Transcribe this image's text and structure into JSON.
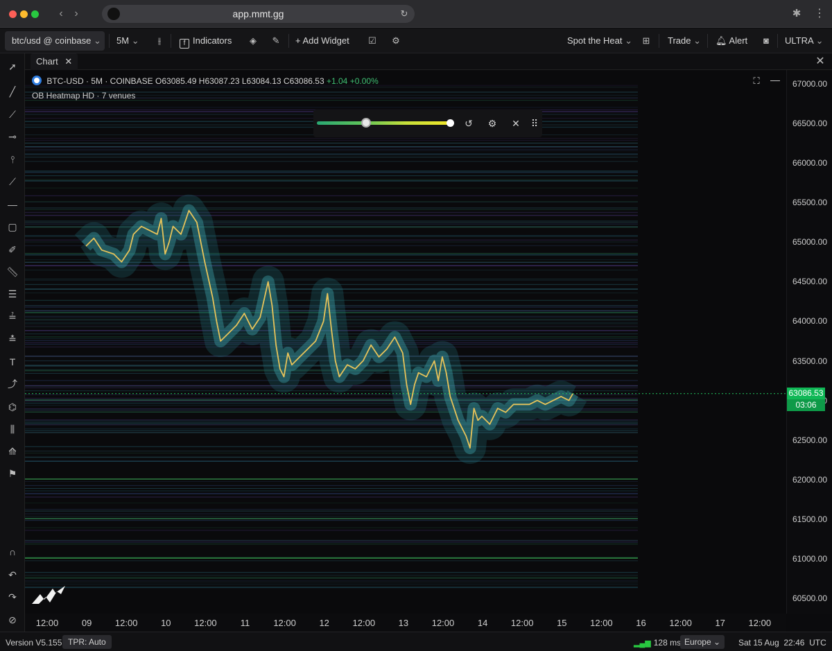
{
  "browser": {
    "url": "app.mmt.gg"
  },
  "toolbar": {
    "symbol": "btc/usd @ coinbase",
    "timeframe": "5M",
    "indicators": "Indicators",
    "add_widget": "+ Add Widget",
    "spot_the_heat": "Spot the Heat",
    "trade": "Trade",
    "alert": "Alert",
    "plan": "ULTRA"
  },
  "tabs": {
    "chart": "Chart"
  },
  "legend": {
    "title": "BTC-USD · 5M · COINBASE",
    "open": "O63085.49",
    "high": "H63087.23",
    "low": "L63084.13",
    "close": "C63086.53",
    "change": "+1.04",
    "change_pct": "+0.00%",
    "indicator": "OB Heatmap HD · 7 venues"
  },
  "heat_slider": {
    "position": 0.37
  },
  "price_axis": {
    "labels": [
      "67000.00",
      "66500.00",
      "66000.00",
      "65500.00",
      "65000.00",
      "64500.00",
      "64000.00",
      "63500.00",
      "63000.00",
      "62500.00",
      "62000.00",
      "61500.00",
      "61000.00",
      "60500.00"
    ],
    "last_price": "63086.53",
    "countdown": "03:06"
  },
  "time_axis": {
    "labels": [
      "12:00",
      "09",
      "12:00",
      "10",
      "12:00",
      "11",
      "12:00",
      "12",
      "12:00",
      "13",
      "12:00",
      "14",
      "12:00",
      "15",
      "12:00",
      "16",
      "12:00",
      "17",
      "12:00"
    ]
  },
  "chart_data": {
    "type": "line",
    "xlabel": "",
    "ylabel": "",
    "ylim": [
      60300,
      67200
    ],
    "price_path": [
      [
        8.0,
        64950
      ],
      [
        8.1,
        65050
      ],
      [
        8.2,
        64900
      ],
      [
        8.35,
        64850
      ],
      [
        8.45,
        64750
      ],
      [
        8.55,
        64900
      ],
      [
        8.6,
        65100
      ],
      [
        8.7,
        65200
      ],
      [
        8.8,
        65150
      ],
      [
        8.9,
        65100
      ],
      [
        8.95,
        65300
      ],
      [
        9.0,
        64850
      ],
      [
        9.05,
        65000
      ],
      [
        9.1,
        65200
      ],
      [
        9.2,
        65100
      ],
      [
        9.3,
        65400
      ],
      [
        9.4,
        65250
      ],
      [
        9.5,
        64750
      ],
      [
        9.6,
        64300
      ],
      [
        9.65,
        64000
      ],
      [
        9.7,
        63750
      ],
      [
        9.8,
        63850
      ],
      [
        9.9,
        63950
      ],
      [
        10.0,
        64100
      ],
      [
        10.1,
        63900
      ],
      [
        10.2,
        64050
      ],
      [
        10.3,
        64500
      ],
      [
        10.35,
        64200
      ],
      [
        10.4,
        63700
      ],
      [
        10.45,
        63400
      ],
      [
        10.5,
        63300
      ],
      [
        10.55,
        63600
      ],
      [
        10.6,
        63450
      ],
      [
        10.7,
        63550
      ],
      [
        10.8,
        63650
      ],
      [
        10.9,
        63750
      ],
      [
        11.0,
        64000
      ],
      [
        11.05,
        64350
      ],
      [
        11.1,
        63900
      ],
      [
        11.15,
        63500
      ],
      [
        11.2,
        63300
      ],
      [
        11.3,
        63450
      ],
      [
        11.4,
        63400
      ],
      [
        11.5,
        63500
      ],
      [
        11.6,
        63700
      ],
      [
        11.7,
        63550
      ],
      [
        11.8,
        63650
      ],
      [
        11.9,
        63800
      ],
      [
        12.0,
        63600
      ],
      [
        12.05,
        63200
      ],
      [
        12.1,
        62950
      ],
      [
        12.15,
        63200
      ],
      [
        12.2,
        63350
      ],
      [
        12.3,
        63300
      ],
      [
        12.4,
        63500
      ],
      [
        12.45,
        63250
      ],
      [
        12.5,
        63550
      ],
      [
        12.55,
        63350
      ],
      [
        12.6,
        63050
      ],
      [
        12.7,
        62750
      ],
      [
        12.8,
        62550
      ],
      [
        12.85,
        62400
      ],
      [
        12.9,
        62900
      ],
      [
        12.95,
        62750
      ],
      [
        13.0,
        62800
      ],
      [
        13.1,
        62700
      ],
      [
        13.2,
        62900
      ],
      [
        13.3,
        62850
      ],
      [
        13.4,
        62950
      ],
      [
        13.5,
        62950
      ],
      [
        13.6,
        62950
      ],
      [
        13.7,
        63000
      ],
      [
        13.8,
        62950
      ],
      [
        14.0,
        63050
      ],
      [
        14.1,
        63000
      ],
      [
        14.15,
        63086.53
      ]
    ]
  }
}
